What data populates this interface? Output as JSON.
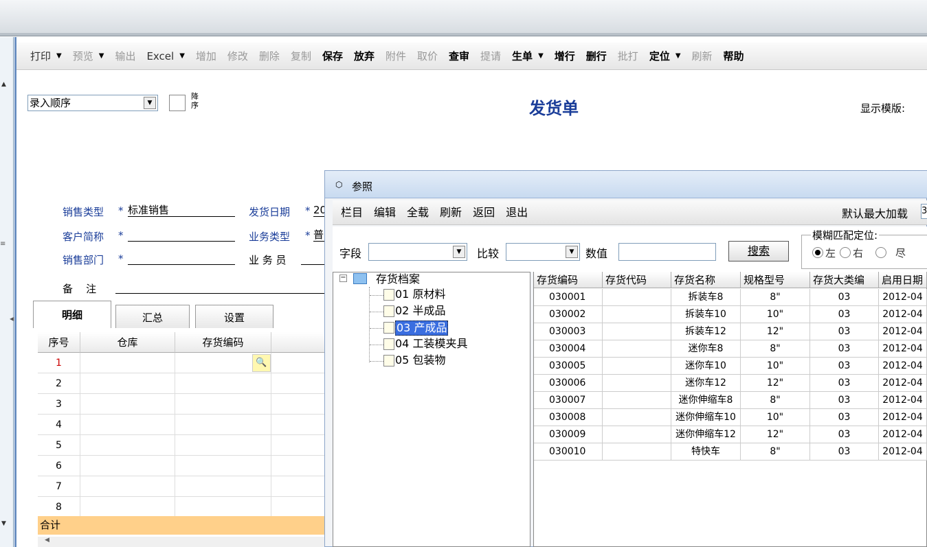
{
  "toolbar": {
    "items": [
      {
        "label": "打印",
        "dropdown": true,
        "enabled": true
      },
      {
        "label": "预览",
        "dropdown": true,
        "enabled": false
      },
      {
        "label": "输出",
        "dropdown": false,
        "enabled": false
      },
      {
        "label": "Excel",
        "dropdown": true,
        "enabled": true
      },
      {
        "label": "增加",
        "dropdown": false,
        "enabled": false
      },
      {
        "label": "修改",
        "dropdown": false,
        "enabled": false
      },
      {
        "label": "删除",
        "dropdown": false,
        "enabled": false
      },
      {
        "label": "复制",
        "dropdown": false,
        "enabled": false
      },
      {
        "label": "保存",
        "dropdown": false,
        "enabled": true
      },
      {
        "label": "放弃",
        "dropdown": false,
        "enabled": true
      },
      {
        "label": "附件",
        "dropdown": false,
        "enabled": false
      },
      {
        "label": "取价",
        "dropdown": false,
        "enabled": false
      },
      {
        "label": "查审",
        "dropdown": false,
        "enabled": true
      },
      {
        "label": "提请",
        "dropdown": false,
        "enabled": false
      },
      {
        "label": "生单",
        "dropdown": true,
        "enabled": true
      },
      {
        "label": "增行",
        "dropdown": false,
        "enabled": true
      },
      {
        "label": "删行",
        "dropdown": false,
        "enabled": true
      },
      {
        "label": "批打",
        "dropdown": false,
        "enabled": false
      },
      {
        "label": "定位",
        "dropdown": true,
        "enabled": true
      },
      {
        "label": "刷新",
        "dropdown": false,
        "enabled": false
      },
      {
        "label": "帮助",
        "dropdown": false,
        "enabled": true
      }
    ]
  },
  "header": {
    "order_select": "录入顺序",
    "desc_label": "降序",
    "title": "发货单",
    "template_label": "显示模版:"
  },
  "form": {
    "sales_type_label": "销售类型",
    "sales_type_value": "标准销售",
    "ship_date_label": "发货日期",
    "ship_date_value": "20",
    "customer_label": "客户简称",
    "customer_value": "",
    "business_type_label": "业务类型",
    "business_type_value": "普",
    "dept_label": "销售部门",
    "dept_value": "",
    "salesperson_label": "业 务 员",
    "salesperson_value": "",
    "remark_label": "备    注",
    "remark_value": "",
    "required_mark": "*"
  },
  "tabs": [
    "明细",
    "汇总",
    "设置"
  ],
  "grid": {
    "columns": [
      "序号",
      "仓库",
      "存货编码"
    ],
    "rows": [
      "1",
      "2",
      "3",
      "4",
      "5",
      "6",
      "7",
      "8"
    ],
    "total_label": "合计"
  },
  "dialog": {
    "title": "参照",
    "menu": [
      "栏目",
      "编辑",
      "全载",
      "刷新",
      "返回",
      "退出"
    ],
    "max_load_label": "默认最大加载",
    "max_load_value": "3",
    "field_label": "字段",
    "field_value": "",
    "compare_label": "比较",
    "compare_value": "",
    "value_label": "数值",
    "value_value": "",
    "search_button": "搜索",
    "fuzzy_label": "模糊匹配定位:",
    "radio_labels": [
      "左",
      "右",
      "尽"
    ],
    "tree": {
      "root": "存货档案",
      "children": [
        "01 原材料",
        "02 半成品",
        "03 产成品",
        "04 工装模夹具",
        "05 包装物"
      ],
      "selected_index": 2
    },
    "table": {
      "columns": [
        "存货编码",
        "存货代码",
        "存货名称",
        "规格型号",
        "存货大类编",
        "启用日期"
      ],
      "rows": [
        [
          "030001",
          "",
          "拆装车8",
          "8\"",
          "03",
          "2012-04"
        ],
        [
          "030002",
          "",
          "拆装车10",
          "10\"",
          "03",
          "2012-04"
        ],
        [
          "030003",
          "",
          "拆装车12",
          "12\"",
          "03",
          "2012-04"
        ],
        [
          "030004",
          "",
          "迷你车8",
          "8\"",
          "03",
          "2012-04"
        ],
        [
          "030005",
          "",
          "迷你车10",
          "10\"",
          "03",
          "2012-04"
        ],
        [
          "030006",
          "",
          "迷你车12",
          "12\"",
          "03",
          "2012-04"
        ],
        [
          "030007",
          "",
          "迷你伸缩车8",
          "8\"",
          "03",
          "2012-04"
        ],
        [
          "030008",
          "",
          "迷你伸缩车10",
          "10\"",
          "03",
          "2012-04"
        ],
        [
          "030009",
          "",
          "迷你伸缩车12",
          "12\"",
          "03",
          "2012-04"
        ],
        [
          "030010",
          "",
          "特快车",
          "8\"",
          "03",
          "2012-04"
        ]
      ]
    }
  }
}
